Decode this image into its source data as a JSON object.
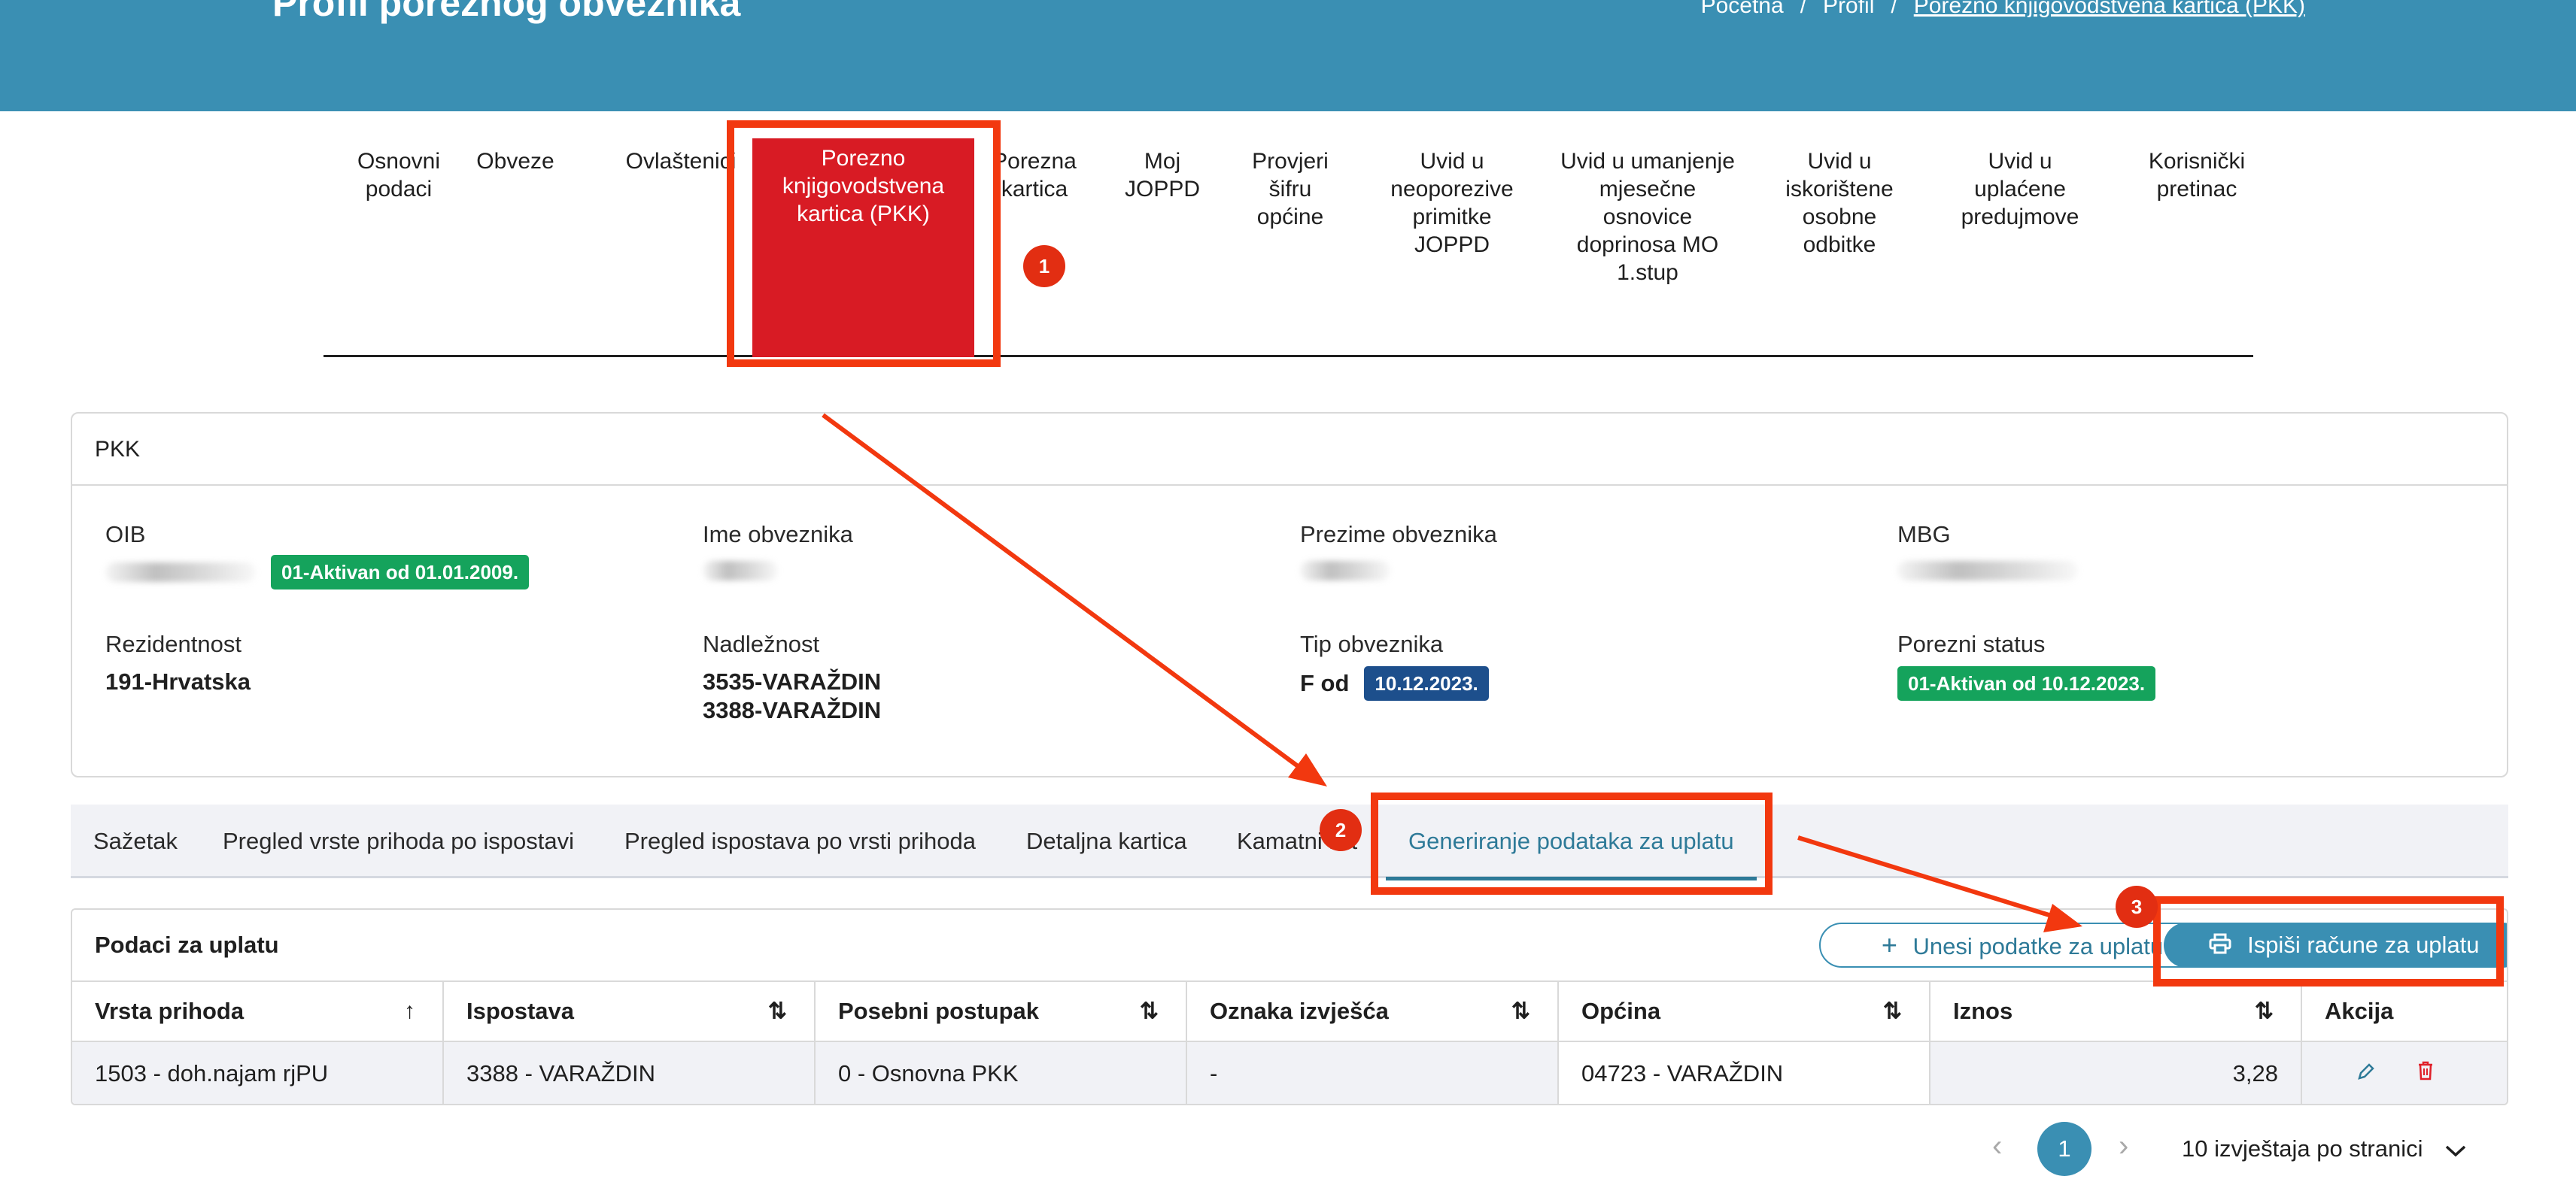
{
  "header": {
    "title": "Profil poreznog obveznika",
    "breadcrumb": [
      "Početna",
      "Profil",
      "Porezno knjigovodstvena kartica (PKK)"
    ]
  },
  "nav": {
    "items": [
      {
        "label": "Osnovni podaci"
      },
      {
        "label": "Obveze"
      },
      {
        "label": "Ovlaštenici"
      },
      {
        "label": "Porezno knjigovodstvena kartica (PKK)",
        "active": true
      },
      {
        "label": "Porezna kartica"
      },
      {
        "label": "Moj JOPPD"
      },
      {
        "label": "Provjeri šifru općine"
      },
      {
        "label": "Uvid u neoporezive primitke JOPPD"
      },
      {
        "label": "Uvid u umanjenje mjesečne osnovice doprinosa MO 1.stup"
      },
      {
        "label": "Uvid u iskorištene osobne odbitke"
      },
      {
        "label": "Uvid u uplaćene predujmove"
      },
      {
        "label": "Korisnički pretinac"
      }
    ]
  },
  "pkk": {
    "heading": "PKK",
    "oib_label": "OIB",
    "oib_badge": "01-Aktivan od 01.01.2009.",
    "ime_label": "Ime obveznika",
    "prezime_label": "Prezime obveznika",
    "mbg_label": "MBG",
    "rezidentnost_label": "Rezidentnost",
    "rezidentnost_value": "191-Hrvatska",
    "nadleznost_label": "Nadležnost",
    "nadleznost_values": [
      "3535-VARAŽDIN",
      "3388-VARAŽDIN"
    ],
    "tip_label": "Tip obveznika",
    "tip_value": "F od",
    "tip_badge": "10.12.2023.",
    "status_label": "Porezni status",
    "status_badge": "01-Aktivan od 10.12.2023."
  },
  "subtabs": [
    {
      "label": "Sažetak"
    },
    {
      "label": "Pregled vrste prihoda po ispostavi"
    },
    {
      "label": "Pregled ispostava po vrsti prihoda"
    },
    {
      "label": "Detaljna kartica"
    },
    {
      "label": "Kamatni list"
    },
    {
      "label": "Generiranje podataka za uplatu",
      "active": true
    }
  ],
  "payments": {
    "title": "Podaci za uplatu",
    "add_button": "Unesi podatke za uplatu",
    "print_button": "Ispiši račune za uplatu",
    "columns": [
      "Vrsta prihoda",
      "Ispostava",
      "Posebni postupak",
      "Oznaka izvješća",
      "Općina",
      "Iznos",
      "Akcija"
    ],
    "rows": [
      [
        "1503 - doh.najam rjPU",
        "3388 - VARAŽDIN",
        "0 - Osnovna PKK",
        "-",
        "04723 - VARAŽDIN",
        "3,28"
      ]
    ]
  },
  "pagination": {
    "current_page": "1",
    "per_page": "10 izvještaja po stranici"
  },
  "annotations": {
    "markers": [
      "1",
      "2",
      "3"
    ],
    "color": "#f2380f"
  },
  "colors": {
    "header": "#3a8fb3",
    "active_nav": "#d81b24",
    "badge_green": "#15a35c",
    "badge_blue": "#1d4f8c"
  }
}
